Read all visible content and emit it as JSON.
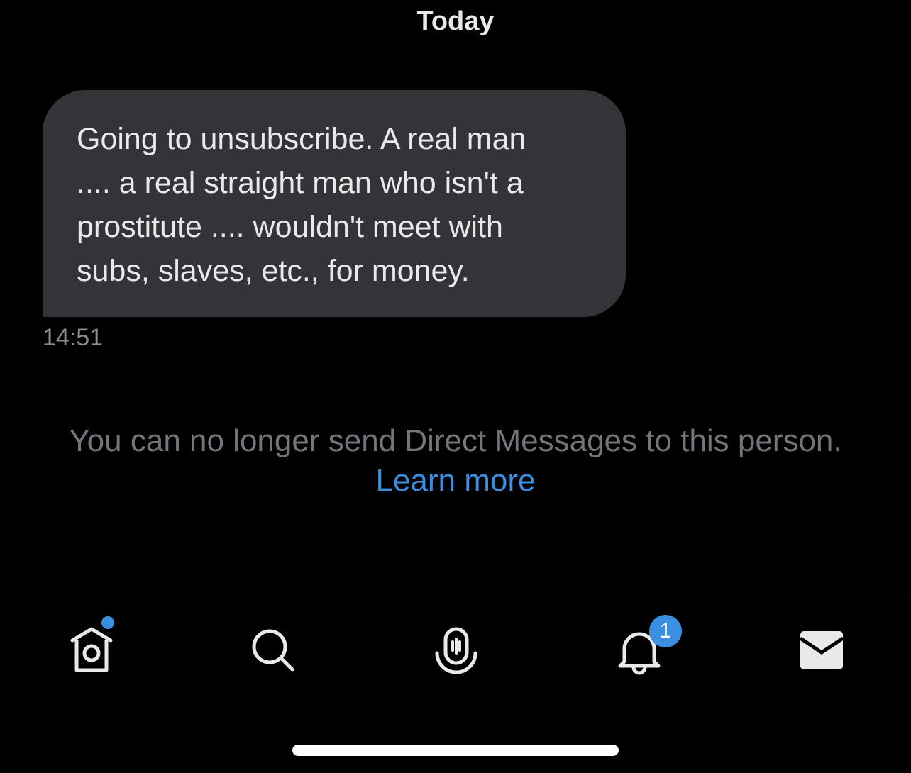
{
  "conversation": {
    "date_header": "Today",
    "messages": [
      {
        "text": "Going to unsubscribe. A real man\n.... a real straight man who isn't a\nprostitute .... wouldn't meet with\nsubs, slaves, etc., for money.",
        "time": "14:51"
      }
    ],
    "notice": {
      "text": "You can no longer send Direct Messages to this person.",
      "link_label": "Learn more"
    }
  },
  "tabbar": {
    "tabs": [
      {
        "name": "home",
        "icon": "home-icon",
        "has_dot": true
      },
      {
        "name": "search",
        "icon": "search-icon"
      },
      {
        "name": "spaces",
        "icon": "spaces-icon"
      },
      {
        "name": "notifications",
        "icon": "bell-icon",
        "badge": "1"
      },
      {
        "name": "messages",
        "icon": "envelope-icon"
      }
    ]
  },
  "colors": {
    "background": "#000000",
    "bubble": "#323437",
    "accent": "#3a8fe0",
    "muted_text": "#71767b"
  }
}
